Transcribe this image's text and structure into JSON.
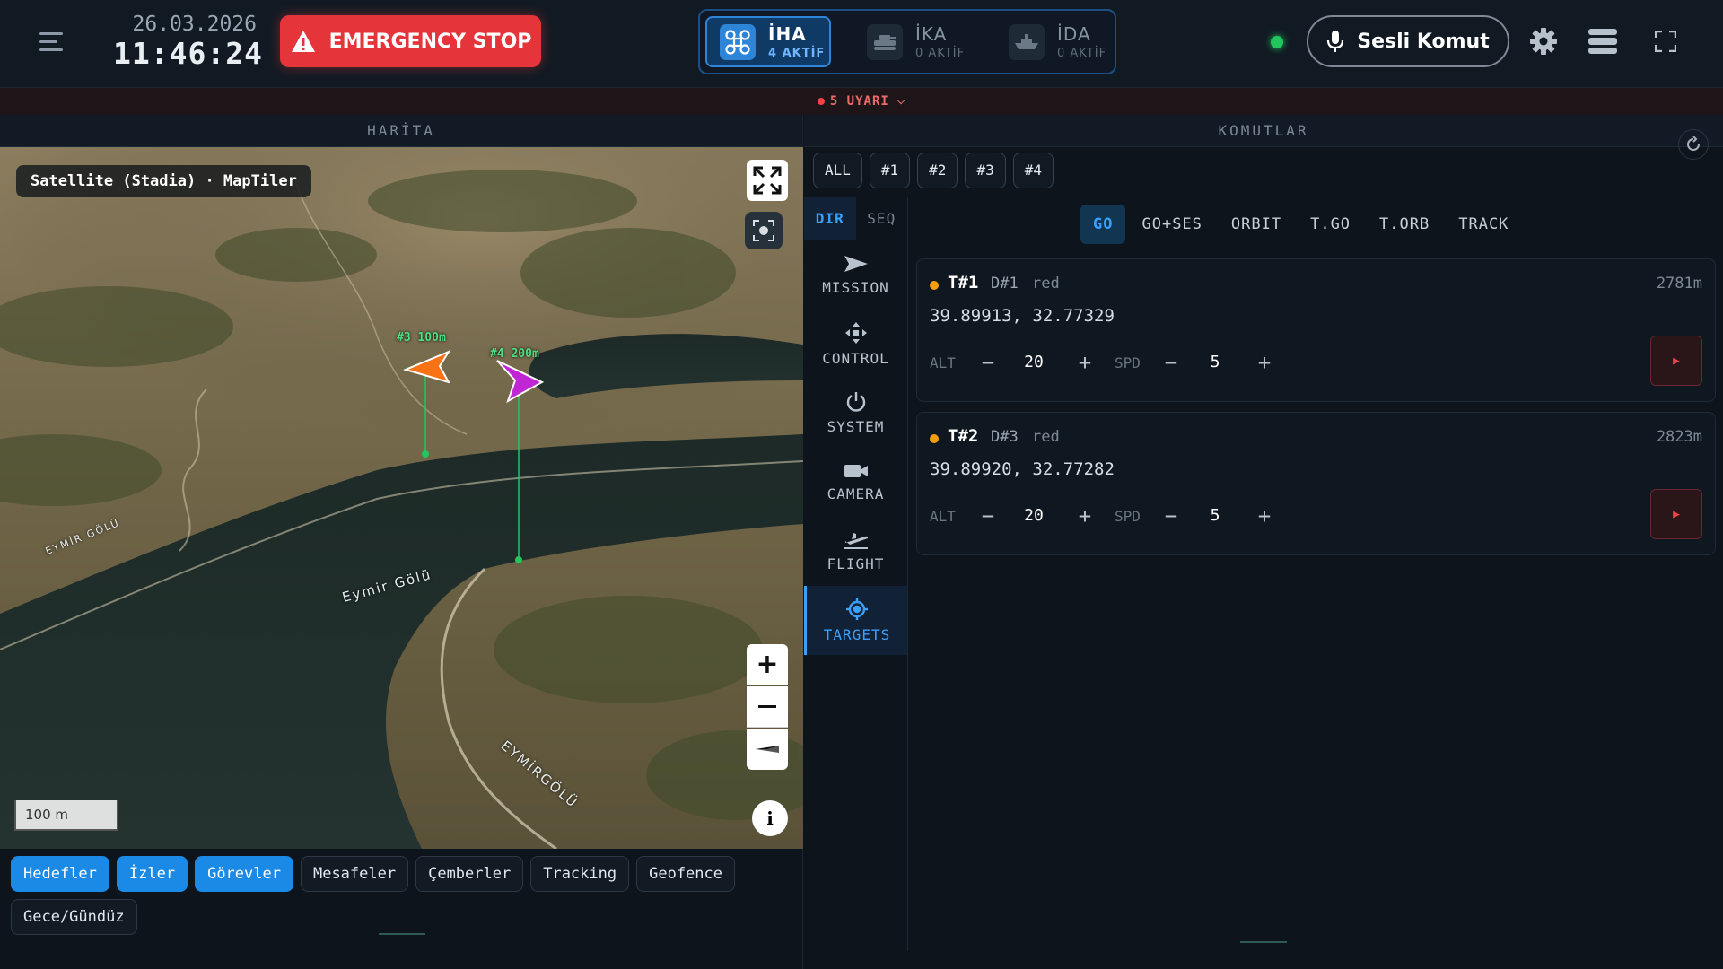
{
  "header": {
    "date": "26.03.2026",
    "time": "11:46:24",
    "emergency_label": "EMERGENCY STOP",
    "vehicles": [
      {
        "name": "İHA",
        "status": "4 AKTİF",
        "icon": "drone-icon",
        "active": true
      },
      {
        "name": "İKA",
        "status": "0 AKTİF",
        "icon": "tank-icon",
        "active": false
      },
      {
        "name": "İDA",
        "status": "0 AKTİF",
        "icon": "boat-icon",
        "active": false
      }
    ],
    "voice_label": "Sesli Komut",
    "colors": {
      "accent": "#2e84d6",
      "danger": "#e5353a",
      "online": "#22c55e"
    }
  },
  "alerts": {
    "label": "5 UYARI"
  },
  "map_panel": {
    "title": "HARİTA",
    "source_label": "Satellite (Stadia) · MapTiler",
    "scale_label": "100 m",
    "drones": [
      {
        "label": "#3 100m",
        "color": "#f97316"
      },
      {
        "label": "#4 200m",
        "color": "#c026d3"
      }
    ],
    "lake_labels": [
      "Eymir Gölü",
      "EYMİR GÖLÜ",
      "EYMİRGÖLÜ"
    ],
    "layers": [
      {
        "label": "Hedefler",
        "on": true
      },
      {
        "label": "İzler",
        "on": true
      },
      {
        "label": "Görevler",
        "on": true
      },
      {
        "label": "Mesafeler",
        "on": false
      },
      {
        "label": "Çemberler",
        "on": false
      },
      {
        "label": "Tracking",
        "on": false
      },
      {
        "label": "Geofence",
        "on": false
      },
      {
        "label": "Gece/Gündüz",
        "on": false
      }
    ]
  },
  "commands_panel": {
    "title": "KOMUTLAR",
    "selectors": [
      "ALL",
      "#1",
      "#2",
      "#3",
      "#4"
    ],
    "modes": [
      {
        "label": "DIR",
        "on": true
      },
      {
        "label": "SEQ",
        "on": false
      }
    ],
    "nav": [
      {
        "label": "MISSION",
        "icon": "send-icon",
        "on": false
      },
      {
        "label": "CONTROL",
        "icon": "move-icon",
        "on": false
      },
      {
        "label": "SYSTEM",
        "icon": "power-icon",
        "on": false
      },
      {
        "label": "CAMERA",
        "icon": "video-icon",
        "on": false
      },
      {
        "label": "FLIGHT",
        "icon": "takeoff-icon",
        "on": false
      },
      {
        "label": "TARGETS",
        "icon": "crosshair-icon",
        "on": true
      }
    ],
    "command_types": [
      {
        "label": "GO",
        "on": true
      },
      {
        "label": "GO+SES",
        "on": false
      },
      {
        "label": "ORBIT",
        "on": false
      },
      {
        "label": "T.GO",
        "on": false
      },
      {
        "label": "T.ORB",
        "on": false
      },
      {
        "label": "TRACK",
        "on": false
      }
    ],
    "targets": [
      {
        "id": "T#1",
        "drone": "D#1",
        "color": "red",
        "distance": "2781m",
        "coords": "39.89913, 32.77329",
        "alt_label": "ALT",
        "alt": "20",
        "spd_label": "SPD",
        "spd": "5"
      },
      {
        "id": "T#2",
        "drone": "D#3",
        "color": "red",
        "distance": "2823m",
        "coords": "39.89920, 32.77282",
        "alt_label": "ALT",
        "alt": "20",
        "spd_label": "SPD",
        "spd": "5"
      }
    ]
  }
}
